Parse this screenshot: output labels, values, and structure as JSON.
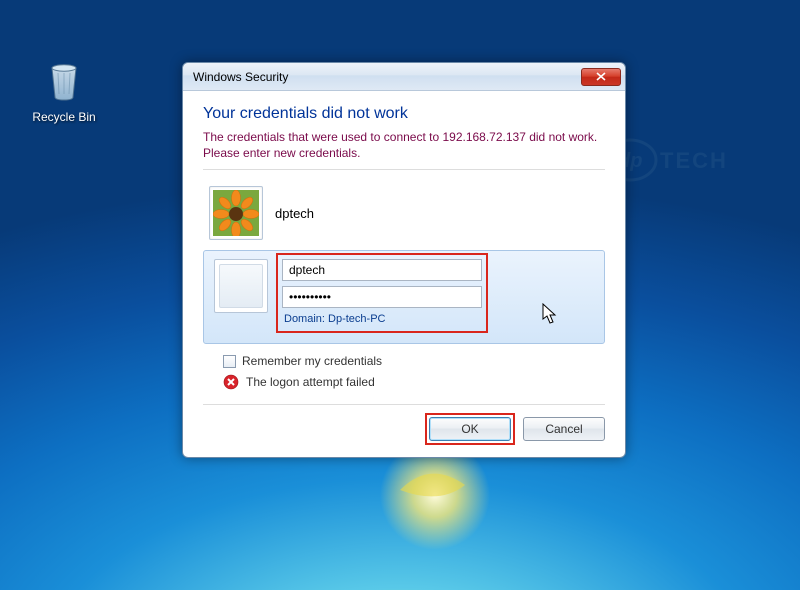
{
  "desktop": {
    "recycle_bin_label": "Recycle Bin"
  },
  "dialog": {
    "title": "Windows Security",
    "heading": "Your credentials did not work",
    "subtext": "The credentials that were used to connect to 192.168.72.137 did not work. Please enter new credentials.",
    "saved_account_name": "dptech",
    "username_value": "dptech",
    "password_value": "••••••••••",
    "domain_label": "Domain: Dp-tech-PC",
    "remember_label": "Remember my credentials",
    "error_label": "The logon attempt failed",
    "ok_label": "OK",
    "cancel_label": "Cancel"
  }
}
